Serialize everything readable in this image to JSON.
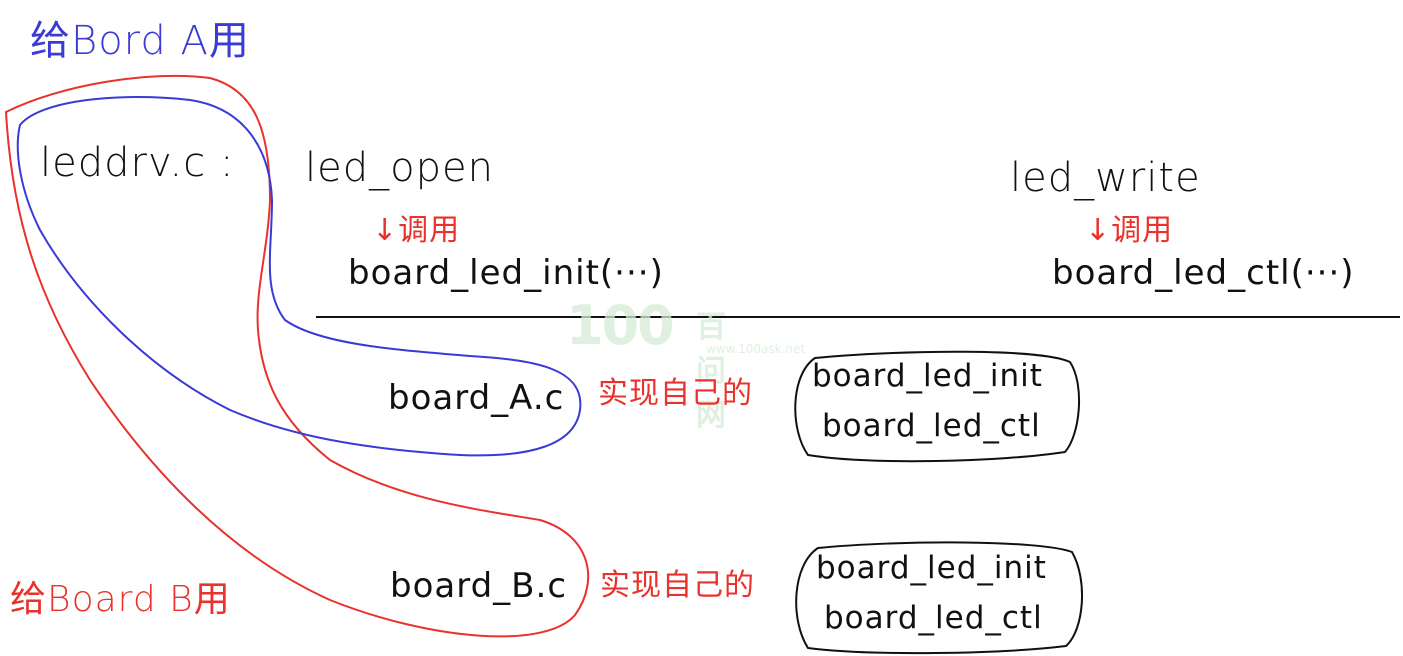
{
  "labels": {
    "board_a_use": "给Bord A用",
    "board_b_use": "给Board B用",
    "leddrv": "leddrv.c :",
    "led_open": "led_open",
    "led_write": "led_write",
    "call_1": "↓调用",
    "call_2": "↓调用",
    "board_led_init_call": "board_led_init(···)",
    "board_led_ctl_call": "board_led_ctl(···)",
    "board_a_file": "board_A.c",
    "board_b_file": "board_B.c",
    "impl_a": "实现自己的",
    "impl_b": "实现自己的",
    "box_a_line1": "board_led_init",
    "box_a_line2": "board_led_ctl",
    "box_b_line1": "board_led_init",
    "box_b_line2": "board_led_ctl"
  },
  "watermark": {
    "number": "100",
    "site_name": "百问网",
    "url": "www.100ask.net"
  },
  "colors": {
    "ink": "#111111",
    "red": "#e8322b",
    "blue": "#3a3ad6",
    "watermark": "#d6ecd6"
  }
}
